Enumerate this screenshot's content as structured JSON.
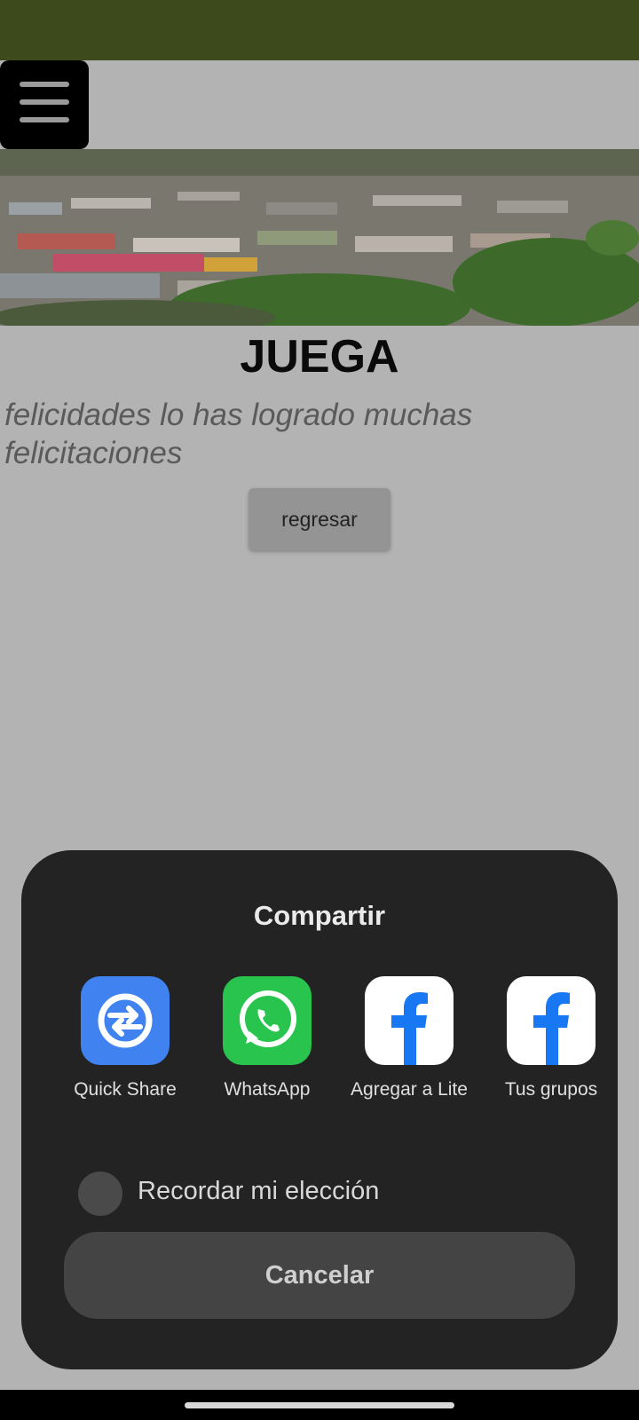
{
  "page": {
    "title": "JUEGA",
    "message": "felicidades lo has logrado muchas felicitaciones",
    "back_label": "regresar"
  },
  "share_sheet": {
    "title": "Compartir",
    "apps": [
      {
        "label": "Quick Share",
        "icon": "quick-share-icon"
      },
      {
        "label": "WhatsApp",
        "icon": "whatsapp-icon"
      },
      {
        "label": "Agregar a Lite",
        "icon": "facebook-lite-icon"
      },
      {
        "label": "Tus grupos",
        "icon": "facebook-groups-icon"
      }
    ],
    "remember_label": "Recordar mi elección",
    "cancel_label": "Cancelar"
  },
  "colors": {
    "topbar": "#3c4a1c",
    "background": "#b3b3b3",
    "sheet": "#232323",
    "quick_share": "#3f82f0",
    "whatsapp": "#29c44d",
    "facebook": "#1877f2"
  }
}
